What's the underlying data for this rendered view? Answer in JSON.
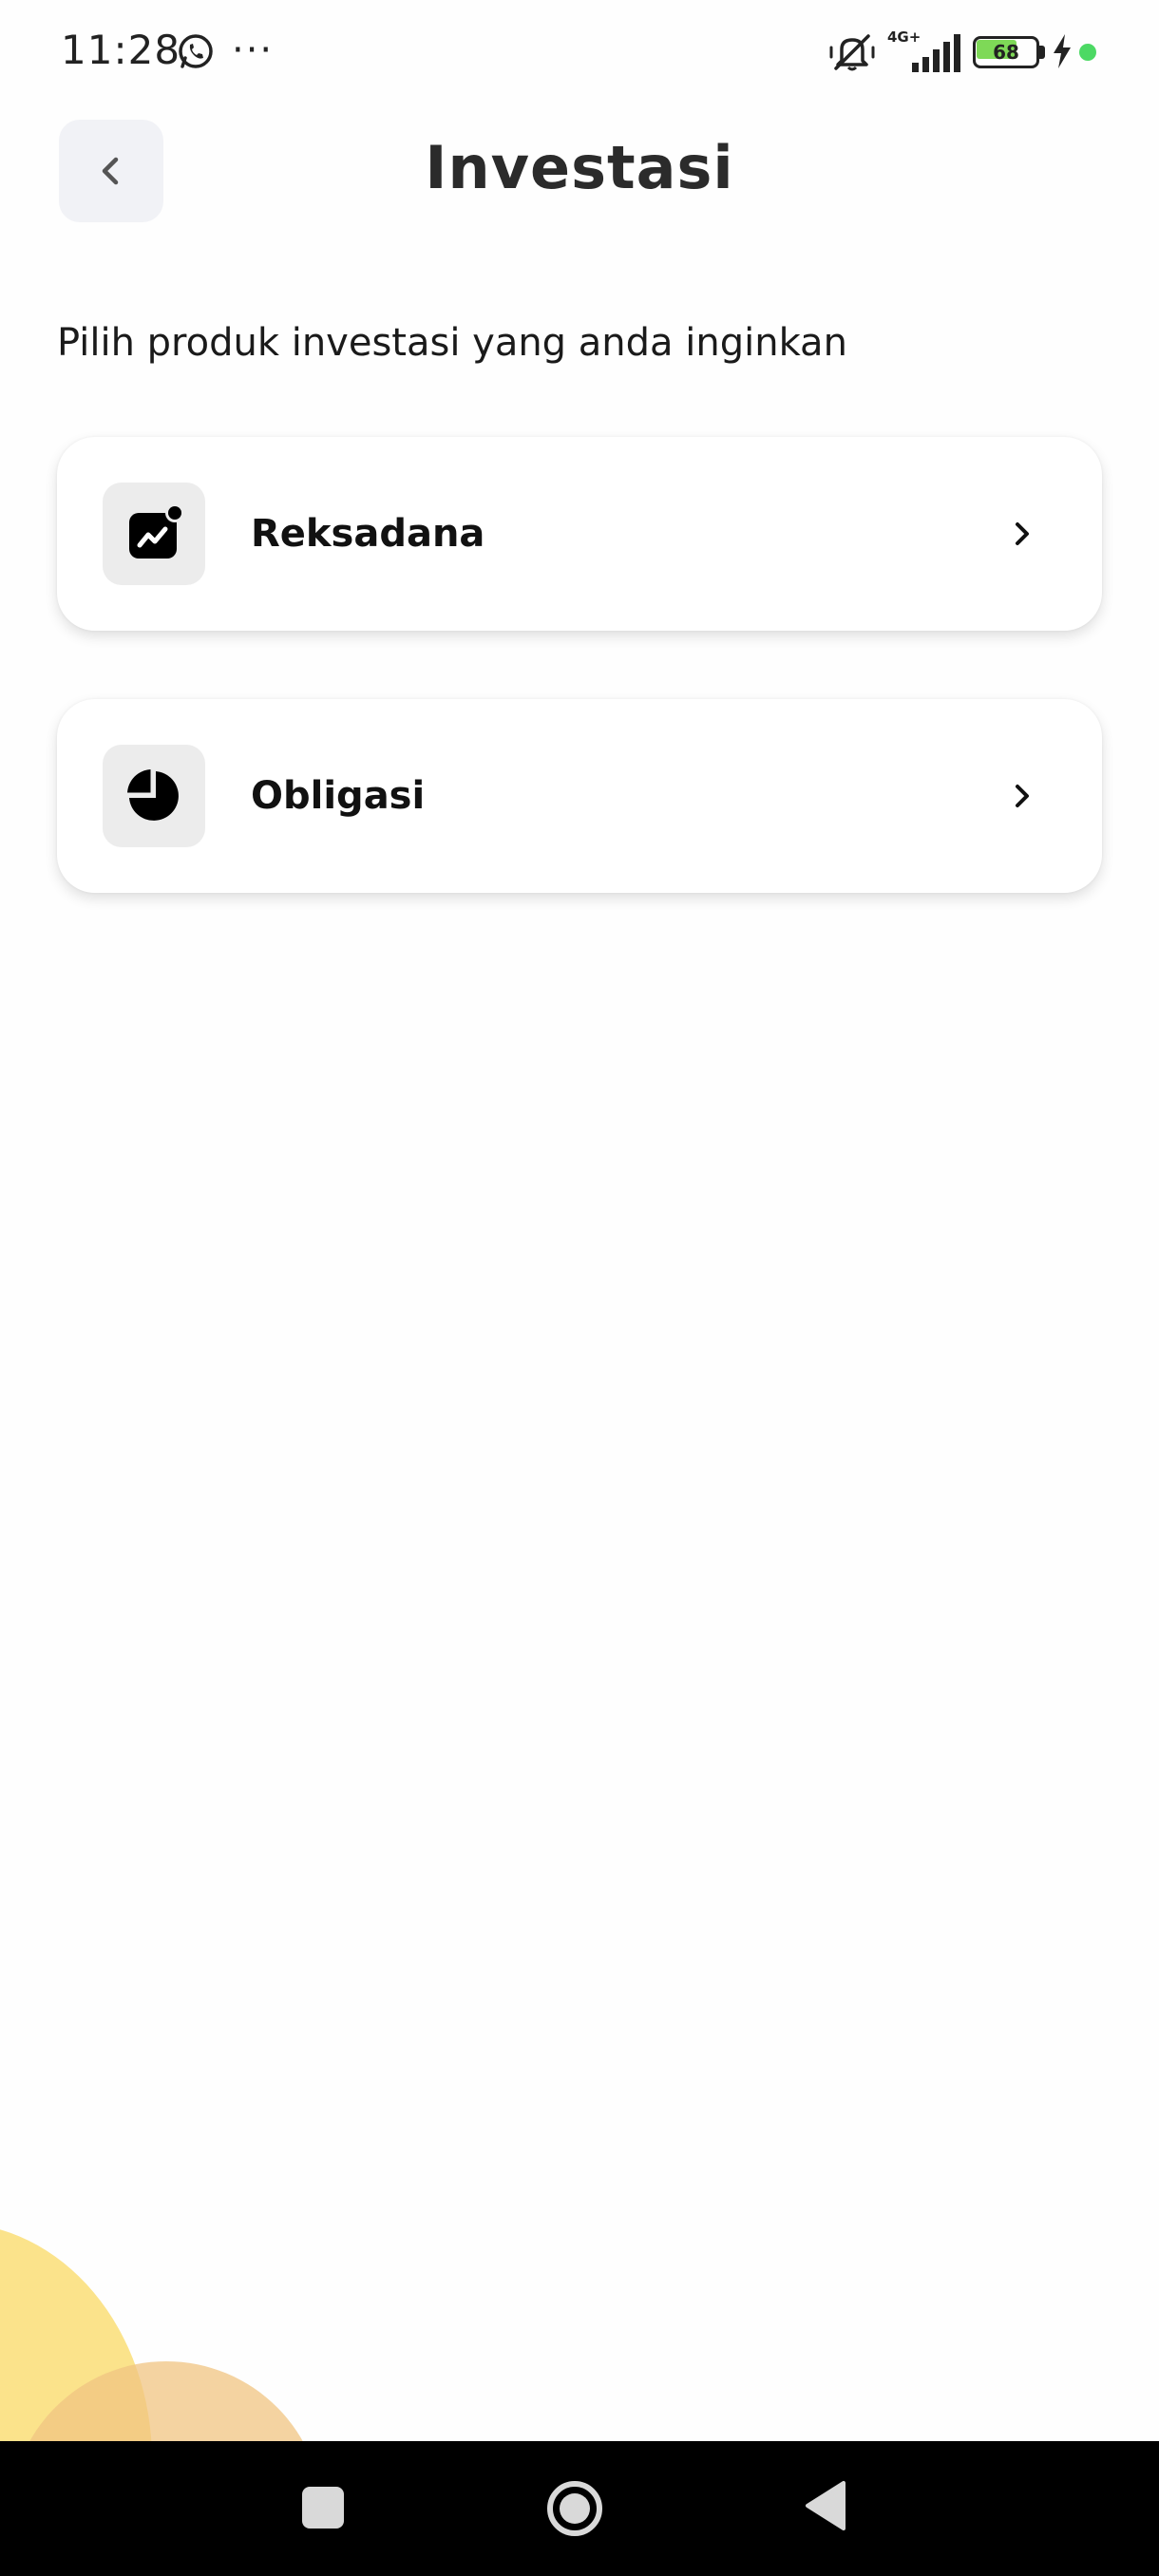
{
  "status_bar": {
    "time": "11:28",
    "more": "···",
    "network": "4G+",
    "battery_level": "68",
    "battery_fraction": 0.68,
    "battery_color": "#7ed957",
    "dot_color": "#4cd964",
    "icons": [
      "whatsapp-icon",
      "more-icon",
      "mute-icon",
      "signal-icon",
      "battery-icon",
      "charging-icon",
      "dot-icon"
    ]
  },
  "header": {
    "title": "Investasi",
    "back_icon": "chevron-left-icon"
  },
  "subtitle": "Pilih produk investasi yang anda inginkan",
  "products": [
    {
      "label": "Reksadana",
      "icon": "chart-trend-icon"
    },
    {
      "label": "Obligasi",
      "icon": "pie-chart-icon"
    }
  ],
  "nav_bar": {
    "icons": [
      "recents-square-icon",
      "home-circle-icon",
      "back-triangle-icon"
    ]
  },
  "colors": {
    "background": "#fefefe",
    "card": "#ffffff",
    "icon_box": "#ececec",
    "back_button": "#f1f2f6",
    "blob_yellow": "#fbe38b",
    "blob_orange": "#f0c482"
  }
}
